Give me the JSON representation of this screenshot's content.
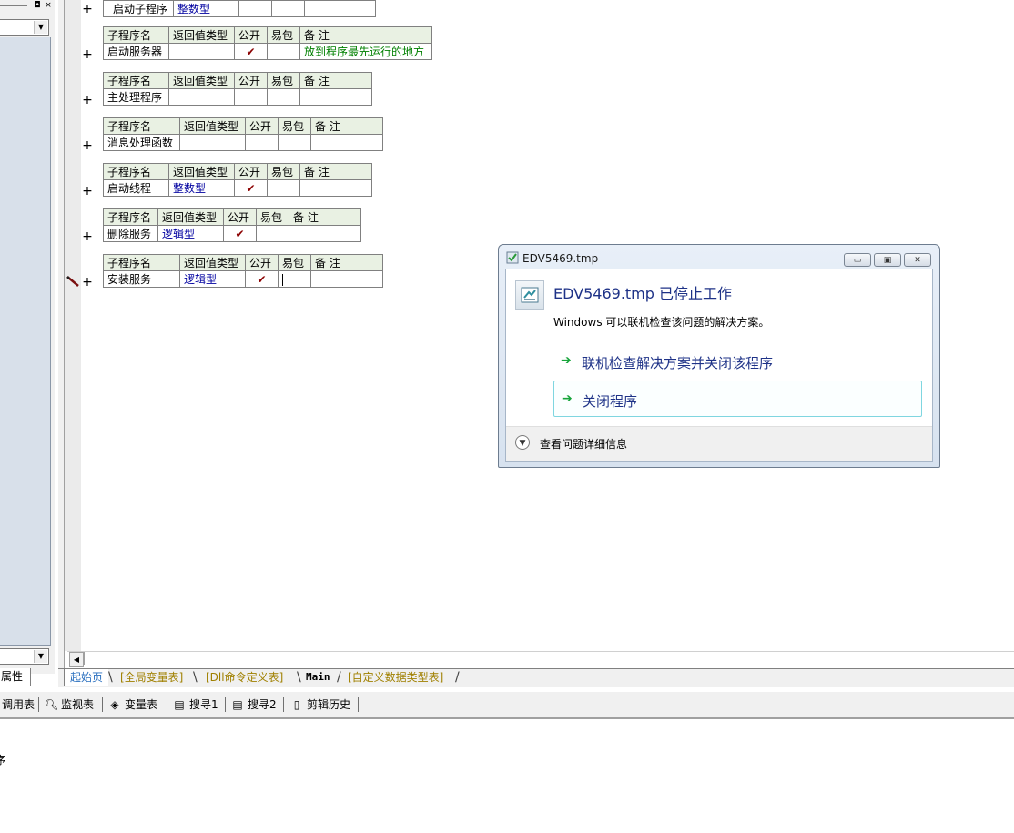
{
  "left_panel": {
    "minimize_glyph": "◘",
    "close_glyph": "×",
    "tab_label": "属性"
  },
  "editor": {
    "table_headers": {
      "name": "子程序名",
      "return_type": "返回值类型",
      "public": "公开",
      "easy_pack": "易包",
      "remark": "备 注"
    },
    "check_glyph": "✔",
    "expand_glyph": "+",
    "subroutines": [
      {
        "name": "_启动子程序",
        "return_type": "整数型",
        "public": "",
        "remark": ""
      },
      {
        "name": "启动服务器",
        "return_type": "",
        "public": "✔",
        "remark": "放到程序最先运行的地方"
      },
      {
        "name": "主处理程序",
        "return_type": "",
        "public": "",
        "remark": ""
      },
      {
        "name": "消息处理函数",
        "return_type": "",
        "public": "",
        "remark": ""
      },
      {
        "name": "启动线程",
        "return_type": "整数型",
        "public": "✔",
        "remark": ""
      },
      {
        "name": "删除服务",
        "return_type": "逻辑型",
        "public": "✔",
        "remark": ""
      },
      {
        "name": "安装服务",
        "return_type": "逻辑型",
        "public": "✔",
        "remark": ""
      }
    ]
  },
  "sheet_tabs": [
    "起始页",
    "[全局变量表]",
    "[Dll命令定义表]",
    "Main",
    "[自定义数据类型表]"
  ],
  "bottom_toolbar": [
    {
      "label": "调用表",
      "icon": "call-table-icon"
    },
    {
      "label": "监视表",
      "icon": "magnifier-icon"
    },
    {
      "label": "变量表",
      "icon": "variable-icon"
    },
    {
      "label": "搜寻1",
      "icon": "search-doc-icon"
    },
    {
      "label": "搜寻2",
      "icon": "search-doc-icon"
    },
    {
      "label": "剪辑历史",
      "icon": "clipboard-icon"
    }
  ],
  "output_text": "序",
  "dialog": {
    "title": "EDV5469.tmp",
    "heading": "EDV5469.tmp 已停止工作",
    "description": "Windows 可以联机检查该问题的解决方案。",
    "option_online": "联机检查解决方案并关闭该程序",
    "option_close": "关闭程序",
    "details": "查看问题详细信息",
    "accent_color": "#1e3287",
    "arrow_color": "#16a43a"
  }
}
